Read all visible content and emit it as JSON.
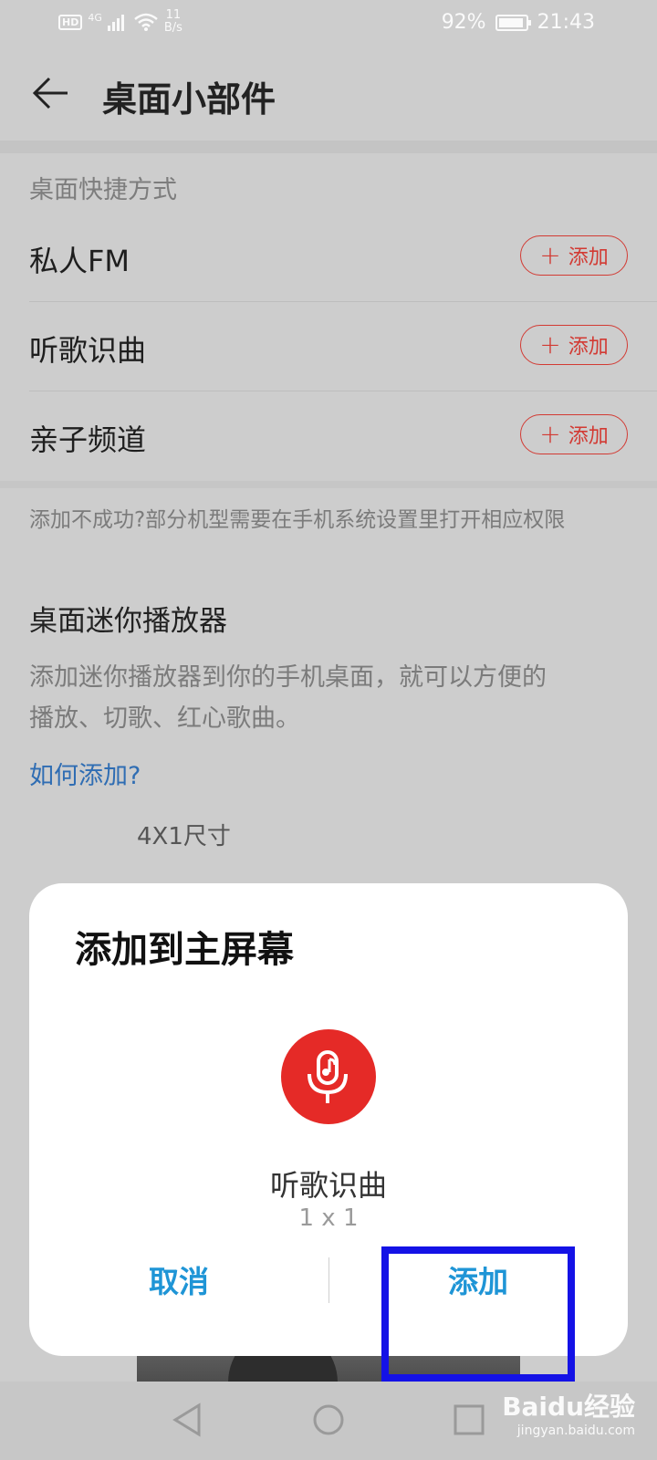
{
  "status_bar": {
    "hd_label": "HD",
    "network_label": "4G",
    "speed_value": "11",
    "speed_unit": "B/s",
    "battery_percent_text": "92%",
    "battery_level": 0.92,
    "time": "21:43"
  },
  "header": {
    "title": "桌面小部件"
  },
  "shortcuts": {
    "section_label": "桌面快捷方式",
    "items": [
      {
        "label": "私人FM",
        "button_label": "添加"
      },
      {
        "label": "听歌识曲",
        "button_label": "添加"
      },
      {
        "label": "亲子频道",
        "button_label": "添加"
      }
    ],
    "hint": "添加不成功?部分机型需要在手机系统设置里打开相应权限"
  },
  "mini_player": {
    "title": "桌面迷你播放器",
    "description_line1": "添加迷你播放器到你的手机桌面，就可以方便的",
    "description_line2": "播放、切歌、红心歌曲。",
    "how_link": "如何添加?",
    "size_label": "4X1尺寸"
  },
  "dialog": {
    "title": "添加到主屏幕",
    "app_name": "听歌识曲",
    "app_size": "1 x 1",
    "cancel_label": "取消",
    "confirm_label": "添加"
  },
  "watermark": {
    "brand": "Baidu经验",
    "url": "jingyan.baidu.com"
  },
  "colors": {
    "accent_red": "#d23a33",
    "dialog_button_blue": "#1f95d6",
    "highlight_blue": "#1412e6",
    "icon_red": "#e52a27"
  },
  "icons": [
    "back-arrow-icon",
    "plus-icon",
    "microphone-music-icon",
    "nav-back-icon",
    "nav-home-icon",
    "nav-recents-icon",
    "wifi-icon",
    "signal-icon",
    "battery-icon"
  ]
}
